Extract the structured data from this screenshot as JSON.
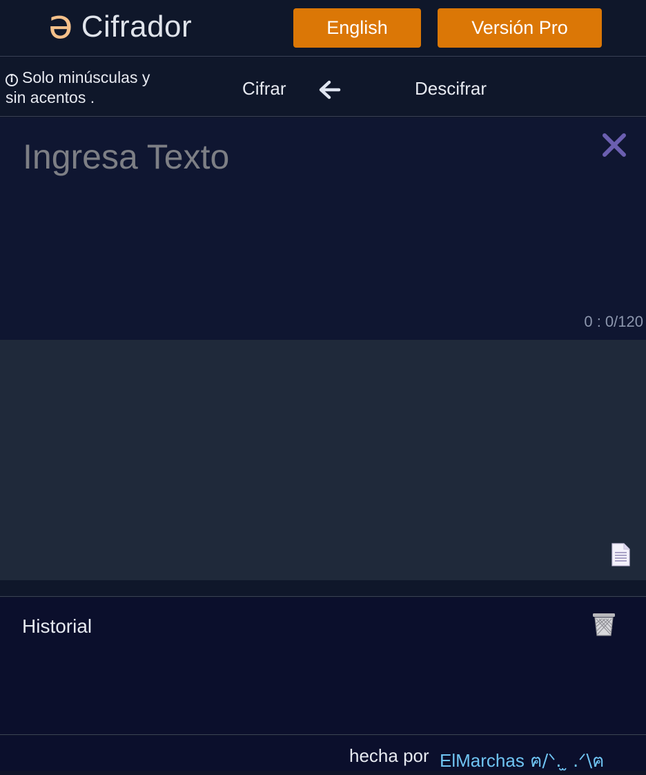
{
  "header": {
    "logo_glyph": "ə",
    "logo_text": "Cifrador",
    "english_button": "English",
    "pro_button": "Versión Pro"
  },
  "modebar": {
    "info_text_line1": "Solo minúsculas y",
    "info_text_line2": "sin acentos .",
    "info_icon": "i",
    "encrypt_label": "Cifrar",
    "decrypt_label": "Descifrar",
    "swap_icon": "arrow-left-icon"
  },
  "input": {
    "placeholder": "Ingresa Texto",
    "value": "",
    "counter": "0 : 0/120",
    "clear_icon": "close-icon"
  },
  "output": {
    "value": "",
    "copy_icon": "document-icon"
  },
  "history": {
    "title": "Historial",
    "items": [],
    "trash_icon": "trash-icon"
  },
  "footer": {
    "made_by": "hecha por",
    "author_name": "ElMarchas",
    "author_face": "ฅ/ᐠ. ̫ .ᐟ\\ฅ"
  },
  "colors": {
    "accent_orange": "#db7706",
    "logo_orange": "#f4c08a",
    "link_blue": "#6fc3f2",
    "clear_icon_purple": "#6b5fb0",
    "header_bg": "#0f172a",
    "input_bg": "#0f1631",
    "output_bg": "#1f293a",
    "history_bg": "#0b0f2c"
  }
}
